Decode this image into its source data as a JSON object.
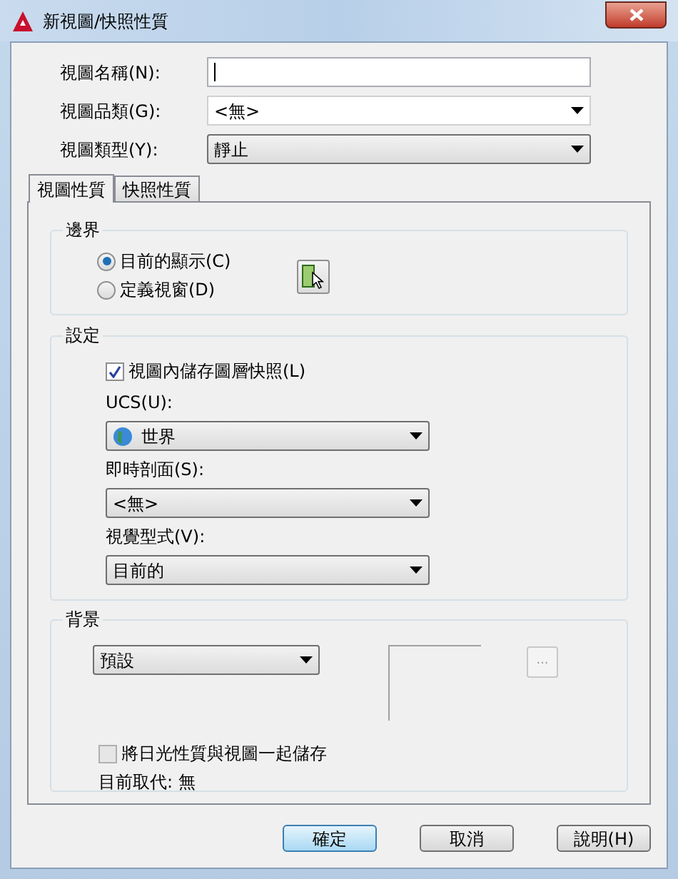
{
  "window": {
    "title": "新視圖/快照性質"
  },
  "fields": [
    {
      "kind": "text",
      "label": "視圖名稱(N):"
    },
    {
      "kind": "combo",
      "label": "視圖品類(G):",
      "value": "<無>"
    },
    {
      "kind": "dropdown",
      "label": "視圖類型(Y):",
      "value": "靜止"
    }
  ],
  "tabs": [
    {
      "label": "視圖性質",
      "selected": true
    },
    {
      "label": "快照性質",
      "selected": false
    }
  ],
  "boundary": {
    "title": "邊界",
    "options": [
      {
        "label": "目前的顯示(C)",
        "selected": true
      },
      {
        "label": "定義視窗(D)",
        "selected": false
      }
    ]
  },
  "settings": {
    "title": "設定",
    "save_layer_snapshot": {
      "label": "視圖內儲存圖層快照(L)",
      "checked": true
    },
    "selects": [
      {
        "label": "UCS(U):",
        "value": "世界"
      },
      {
        "label": "即時剖面(S):",
        "value": "<無>"
      },
      {
        "label": "視覺型式(V):",
        "value": "目前的"
      }
    ]
  },
  "background": {
    "title": "背景",
    "value": "預設",
    "browse_button": "...",
    "save_sun": {
      "label": "將日光性質與視圖一起儲存",
      "checked": false,
      "disabled": true
    },
    "current_override": "目前取代: 無"
  },
  "buttons": [
    {
      "label": "確定",
      "default": true
    },
    {
      "label": "取消",
      "default": false
    },
    {
      "label": "說明(H)",
      "default": false
    }
  ]
}
